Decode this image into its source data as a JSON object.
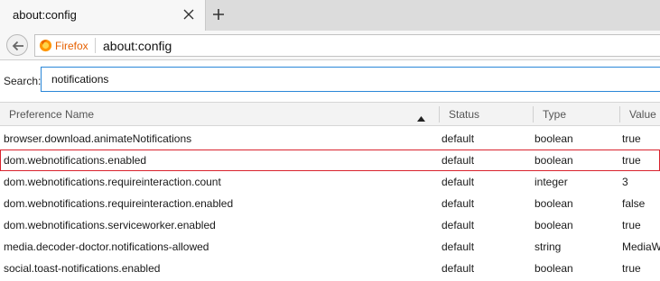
{
  "tab": {
    "title": "about:config"
  },
  "navbar": {
    "identity_label": "Firefox",
    "url": "about:config"
  },
  "search": {
    "label": "Search:",
    "value": "notifications"
  },
  "table": {
    "columns": [
      "Preference Name",
      "Status",
      "Type",
      "Value"
    ],
    "sort_column": "Preference Name",
    "rows": [
      {
        "name": "browser.download.animateNotifications",
        "status": "default",
        "type": "boolean",
        "value": "true"
      },
      {
        "name": "dom.webnotifications.enabled",
        "status": "default",
        "type": "boolean",
        "value": "true"
      },
      {
        "name": "dom.webnotifications.requireinteraction.count",
        "status": "default",
        "type": "integer",
        "value": "3"
      },
      {
        "name": "dom.webnotifications.requireinteraction.enabled",
        "status": "default",
        "type": "boolean",
        "value": "false"
      },
      {
        "name": "dom.webnotifications.serviceworker.enabled",
        "status": "default",
        "type": "boolean",
        "value": "true"
      },
      {
        "name": "media.decoder-doctor.notifications-allowed",
        "status": "default",
        "type": "string",
        "value": "MediaW"
      },
      {
        "name": "social.toast-notifications.enabled",
        "status": "default",
        "type": "boolean",
        "value": "true"
      }
    ],
    "highlighted_row": "dom.webnotifications.enabled"
  },
  "colors": {
    "highlight_border": "#d9232e",
    "search_focus": "#2a87d8",
    "identity": "#e66000"
  },
  "icons": [
    "close-icon",
    "plus-icon",
    "back-arrow-icon",
    "firefox-logo-icon",
    "sort-up-icon"
  ]
}
